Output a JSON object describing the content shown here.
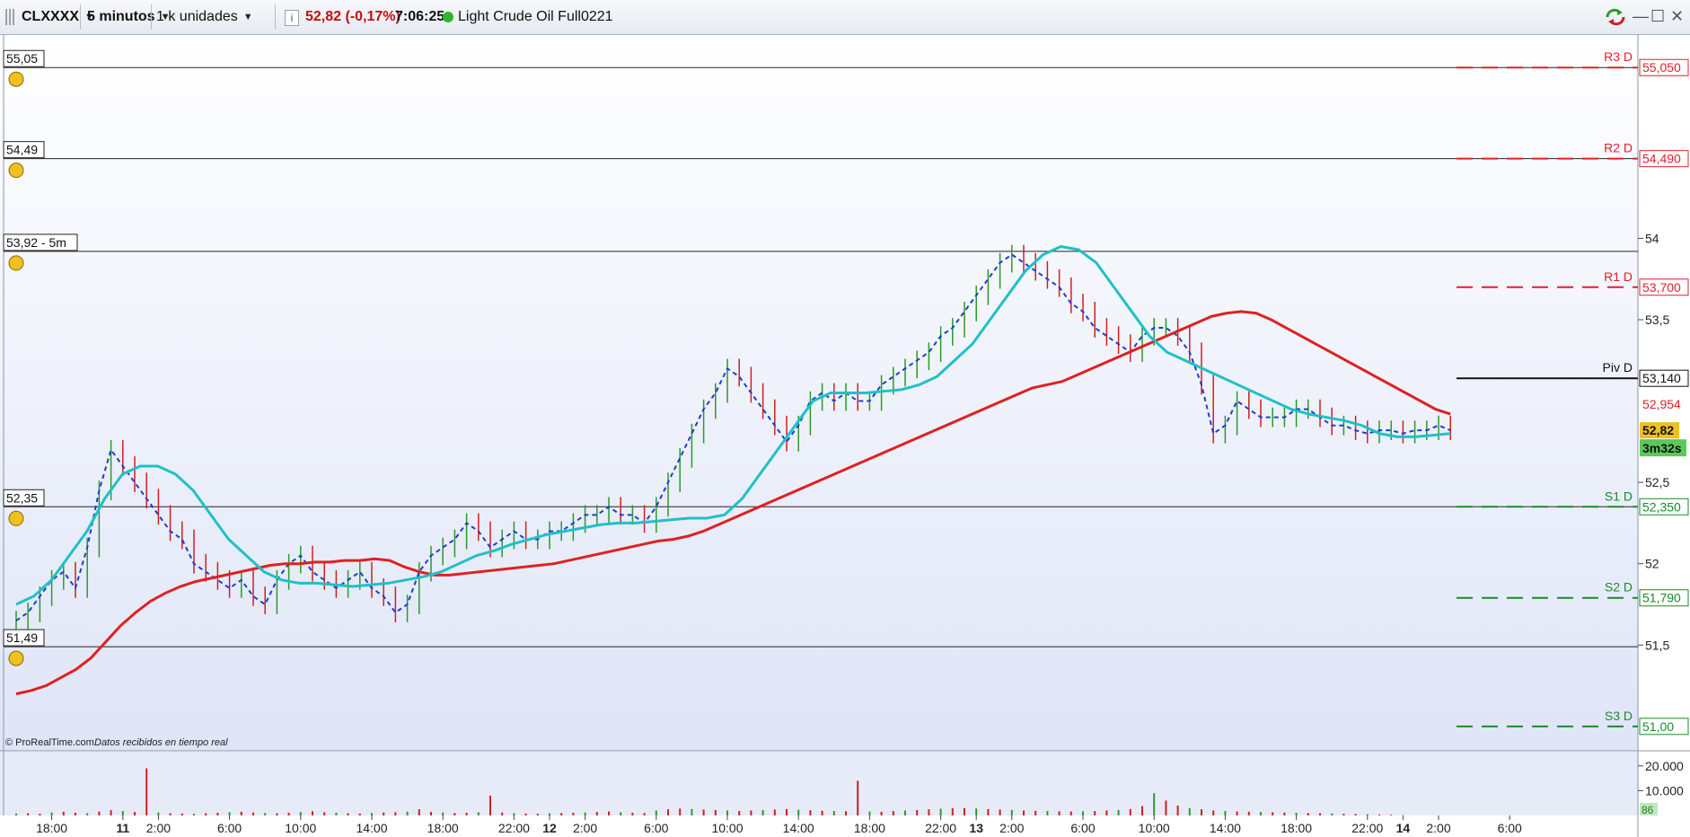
{
  "toolbar": {
    "symbol": "CLXXXX",
    "timeframe": "5 minutos",
    "units": "1 k unidades",
    "info_icon": "info-icon",
    "price_change": "52,82 (-0,17%)",
    "time": "7:06:25",
    "status_color": "#2fb82f",
    "instrument": "Light Crude Oil Full0221",
    "refresh_icon": "refresh-icon",
    "minimize_icon": "minimize-icon",
    "maximize_icon": "maximize-icon",
    "close_icon": "close-icon"
  },
  "footer": {
    "copyright": "© ProRealTime.com",
    "status": "Datos recibidos en tiempo real"
  },
  "alerts": [
    {
      "label": "55,05",
      "price": 55.05,
      "icon": "bell-icon"
    },
    {
      "label": "54,49",
      "price": 54.49,
      "icon": "bell-icon"
    },
    {
      "label": "53,92 - 5m",
      "price": 53.92,
      "icon": "bell-icon"
    },
    {
      "label": "52,35",
      "price": 52.35,
      "icon": "bell-icon"
    },
    {
      "label": "51,49",
      "price": 51.49,
      "icon": "bell-icon"
    }
  ],
  "pivots": [
    {
      "name": "R3 D",
      "value": 55.05,
      "label": "55,050",
      "color": "#e0202a"
    },
    {
      "name": "R2 D",
      "value": 54.49,
      "label": "54,490",
      "color": "#e0202a"
    },
    {
      "name": "R1 D",
      "value": 53.7,
      "label": "53,700",
      "color": "#e0202a"
    },
    {
      "name": "Piv D",
      "value": 53.14,
      "label": "53,140",
      "color": "#111111"
    },
    {
      "name": "S1 D",
      "value": 52.35,
      "label": "52,350",
      "color": "#1a8a2a"
    },
    {
      "name": "S2 D",
      "value": 51.79,
      "label": "51,790",
      "color": "#1a8a2a"
    },
    {
      "name": "S3 D",
      "value": 51.0,
      "label": "51,00",
      "color": "#1a8a2a"
    }
  ],
  "right_labels": {
    "ma_value": "52,954",
    "last_price": "52,82",
    "countdown": "3m32s",
    "volume_last": "86"
  },
  "chart_data": {
    "type": "line",
    "instrument": "Light Crude Oil Full0221",
    "timeframe": "5 minutos",
    "ylim": [
      50.85,
      55.25
    ],
    "y_ticks": [
      {
        "v": 54,
        "label": "54"
      },
      {
        "v": 53.5,
        "label": "53,5"
      },
      {
        "v": 52.5,
        "label": "52,5"
      },
      {
        "v": 52,
        "label": "52"
      },
      {
        "v": 51.5,
        "label": "51,5"
      }
    ],
    "volume_ticks": [
      {
        "v": 20000,
        "label": "20.000"
      },
      {
        "v": 10000,
        "label": "10.000"
      }
    ],
    "volume_ylim": [
      0,
      25000
    ],
    "x_ticks": [
      {
        "i": 3,
        "label": "18:00",
        "bold": false
      },
      {
        "i": 9,
        "label": "11",
        "bold": true
      },
      {
        "i": 12,
        "label": "2:00",
        "bold": false
      },
      {
        "i": 18,
        "label": "6:00",
        "bold": false
      },
      {
        "i": 24,
        "label": "10:00",
        "bold": false
      },
      {
        "i": 30,
        "label": "14:00",
        "bold": false
      },
      {
        "i": 36,
        "label": "18:00",
        "bold": false
      },
      {
        "i": 42,
        "label": "22:00",
        "bold": false
      },
      {
        "i": 45,
        "label": "12",
        "bold": true
      },
      {
        "i": 48,
        "label": "2:00",
        "bold": false
      },
      {
        "i": 54,
        "label": "6:00",
        "bold": false
      },
      {
        "i": 60,
        "label": "10:00",
        "bold": false
      },
      {
        "i": 66,
        "label": "14:00",
        "bold": false
      },
      {
        "i": 72,
        "label": "18:00",
        "bold": false
      },
      {
        "i": 78,
        "label": "22:00",
        "bold": false
      },
      {
        "i": 81,
        "label": "13",
        "bold": true
      },
      {
        "i": 84,
        "label": "2:00",
        "bold": false
      },
      {
        "i": 90,
        "label": "6:00",
        "bold": false
      },
      {
        "i": 96,
        "label": "10:00",
        "bold": false
      },
      {
        "i": 102,
        "label": "14:00",
        "bold": false
      },
      {
        "i": 108,
        "label": "18:00",
        "bold": false
      },
      {
        "i": 114,
        "label": "22:00",
        "bold": false
      },
      {
        "i": 117,
        "label": "14",
        "bold": true
      },
      {
        "i": 120,
        "label": "2:00",
        "bold": false
      },
      {
        "i": 126,
        "label": "6:00",
        "bold": false
      }
    ],
    "series": [
      {
        "name": "price",
        "color": "#2a9a2a",
        "values": [
          51.65,
          51.7,
          51.8,
          51.9,
          51.95,
          51.85,
          52.1,
          52.45,
          52.7,
          52.6,
          52.5,
          52.4,
          52.3,
          52.2,
          52.15,
          52.0,
          51.95,
          51.9,
          51.85,
          51.9,
          51.8,
          51.75,
          51.9,
          52.0,
          52.05,
          51.95,
          51.9,
          51.85,
          51.9,
          51.95,
          51.85,
          51.8,
          51.7,
          51.75,
          51.95,
          52.05,
          52.1,
          52.15,
          52.25,
          52.2,
          52.1,
          52.15,
          52.2,
          52.15,
          52.15,
          52.2,
          52.2,
          52.25,
          52.3,
          52.3,
          52.35,
          52.3,
          52.3,
          52.25,
          52.35,
          52.5,
          52.65,
          52.8,
          52.95,
          53.05,
          53.2,
          53.15,
          53.05,
          52.95,
          52.85,
          52.75,
          52.85,
          53.0,
          53.05,
          53.0,
          53.05,
          53.0,
          53.0,
          53.1,
          53.15,
          53.2,
          53.25,
          53.3,
          53.4,
          53.45,
          53.55,
          53.65,
          53.75,
          53.85,
          53.9,
          53.85,
          53.8,
          53.75,
          53.7,
          53.6,
          53.55,
          53.45,
          53.4,
          53.35,
          53.3,
          53.4,
          53.45,
          53.45,
          53.4,
          53.3,
          53.1,
          52.8,
          52.85,
          53.0,
          52.95,
          52.9,
          52.9,
          52.9,
          52.95,
          52.95,
          52.9,
          52.85,
          52.85,
          52.82,
          52.8,
          52.82,
          52.82,
          52.8,
          52.82,
          52.82,
          52.85,
          52.82
        ]
      },
      {
        "name": "moving-average-long",
        "color": "#e02020",
        "values": [
          51.2,
          51.22,
          51.25,
          51.3,
          51.35,
          51.42,
          51.52,
          51.62,
          51.7,
          51.77,
          51.82,
          51.86,
          51.89,
          51.91,
          51.93,
          51.95,
          51.97,
          51.99,
          52.0,
          52.0,
          52.01,
          52.01,
          52.02,
          52.02,
          52.03,
          52.02,
          51.98,
          51.95,
          51.93,
          51.93,
          51.94,
          51.95,
          51.96,
          51.97,
          51.98,
          51.99,
          52.0,
          52.02,
          52.04,
          52.06,
          52.08,
          52.1,
          52.12,
          52.14,
          52.15,
          52.17,
          52.2,
          52.24,
          52.28,
          52.32,
          52.36,
          52.4,
          52.44,
          52.48,
          52.52,
          52.56,
          52.6,
          52.64,
          52.68,
          52.72,
          52.76,
          52.8,
          52.84,
          52.88,
          52.92,
          52.96,
          53.0,
          53.04,
          53.08,
          53.1,
          53.12,
          53.16,
          53.2,
          53.24,
          53.28,
          53.32,
          53.36,
          53.4,
          53.44,
          53.48,
          53.52,
          53.54,
          53.55,
          53.54,
          53.5,
          53.45,
          53.4,
          53.35,
          53.3,
          53.25,
          53.2,
          53.15,
          53.1,
          53.05,
          53.0,
          52.95,
          52.92
        ],
        "start": 0
      },
      {
        "name": "moving-average-short",
        "color": "#20c0c8",
        "values": [
          51.75,
          51.8,
          51.9,
          52.05,
          52.2,
          52.4,
          52.55,
          52.6,
          52.6,
          52.55,
          52.45,
          52.3,
          52.15,
          52.05,
          51.95,
          51.9,
          51.88,
          51.88,
          51.87,
          51.86,
          51.87,
          51.88,
          51.9,
          51.92,
          51.95,
          52.0,
          52.05,
          52.08,
          52.12,
          52.15,
          52.18,
          52.2,
          52.22,
          52.24,
          52.25,
          52.25,
          52.26,
          52.27,
          52.28,
          52.28,
          52.3,
          52.4,
          52.55,
          52.7,
          52.85,
          53.0,
          53.05,
          53.05,
          53.05,
          53.06,
          53.07,
          53.1,
          53.15,
          53.25,
          53.35,
          53.5,
          53.65,
          53.8,
          53.9,
          53.95,
          53.93,
          53.85,
          53.7,
          53.55,
          53.4,
          53.3,
          53.25,
          53.2,
          53.15,
          53.1,
          53.05,
          53.0,
          52.95,
          52.92,
          52.9,
          52.88,
          52.85,
          52.8,
          52.78,
          52.78,
          52.79,
          52.8
        ],
        "start": 0
      },
      {
        "name": "volume",
        "color": "#cc2020",
        "values": [
          800,
          900,
          700,
          1200,
          1500,
          1100,
          900,
          1600,
          2200,
          1800,
          1400,
          19000,
          1200,
          900,
          800,
          700,
          900,
          1100,
          1300,
          1500,
          1200,
          1000,
          900,
          1100,
          1400,
          1700,
          1300,
          1100,
          900,
          800,
          1000,
          1200,
          1300,
          1500,
          2500,
          1400,
          1200,
          1000,
          1100,
          1300,
          8000,
          1200,
          900,
          800,
          700,
          900,
          1000,
          1100,
          1200,
          1400,
          1600,
          1300,
          1100,
          1000,
          2000,
          2500,
          2800,
          2600,
          2400,
          2200,
          2000,
          1800,
          2000,
          2200,
          2400,
          2600,
          2300,
          2100,
          1900,
          1800,
          1700,
          14000,
          1600,
          1500,
          1800,
          2000,
          2200,
          2500,
          2700,
          2900,
          3000,
          2800,
          2600,
          2400,
          2200,
          2000,
          1900,
          1800,
          1700,
          1600,
          1700,
          1800,
          2000,
          2200,
          2600,
          3800,
          9000,
          6000,
          4000,
          3000,
          2500,
          2000,
          1800,
          1600,
          1500,
          1400,
          1300,
          1200,
          1100,
          1000,
          900,
          800,
          700,
          600,
          500,
          400,
          300,
          86
        ]
      }
    ]
  }
}
